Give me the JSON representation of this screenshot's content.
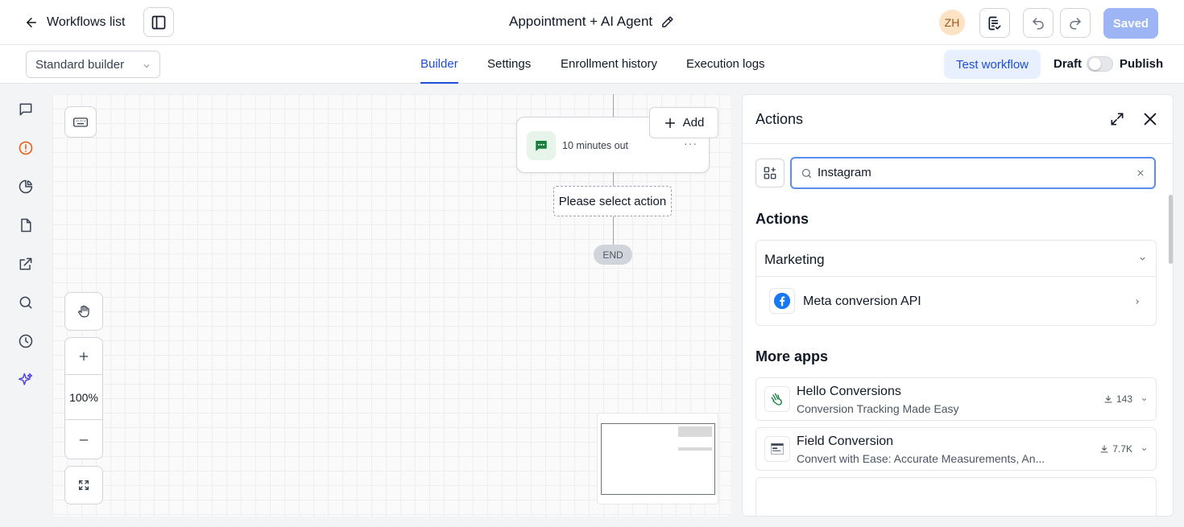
{
  "header": {
    "back_label": "Workflows list",
    "workflow_title": "Appointment + AI Agent",
    "avatar_initials": "ZH",
    "saved_label": "Saved"
  },
  "subbar": {
    "builder_select": "Standard builder",
    "tabs": [
      {
        "label": "Builder",
        "active": true
      },
      {
        "label": "Settings",
        "active": false
      },
      {
        "label": "Enrollment history",
        "active": false
      },
      {
        "label": "Execution logs",
        "active": false
      }
    ],
    "test_workflow_label": "Test workflow",
    "draft_label": "Draft",
    "publish_label": "Publish"
  },
  "rail": {
    "icons": [
      "chat-icon",
      "alert-icon",
      "pie-chart-icon",
      "document-icon",
      "external-link-icon",
      "search-icon",
      "history-icon",
      "sparkles-icon"
    ]
  },
  "canvas": {
    "node_label": "10 minutes out",
    "add_label": "Add",
    "select_action_label": "Please select action",
    "end_label": "END",
    "zoom_level": "100%"
  },
  "panel": {
    "title": "Actions",
    "search_value": "Instagram",
    "actions_heading": "Actions",
    "group": {
      "title": "Marketing",
      "item_label": "Meta conversion API"
    },
    "more_apps_heading": "More apps",
    "apps": [
      {
        "name": "Hello Conversions",
        "description": "Conversion Tracking Made Easy",
        "downloads": "143"
      },
      {
        "name": "Field Conversion",
        "description": "Convert with Ease: Accurate Measurements, An...",
        "downloads": "7.7K"
      }
    ]
  },
  "colors": {
    "accent": "#1d4ed8",
    "saved_button": "#9db5f5",
    "facebook": "#1877f2",
    "alert_orange": "#ea580c",
    "sparkle_purple": "#4f46e5"
  }
}
